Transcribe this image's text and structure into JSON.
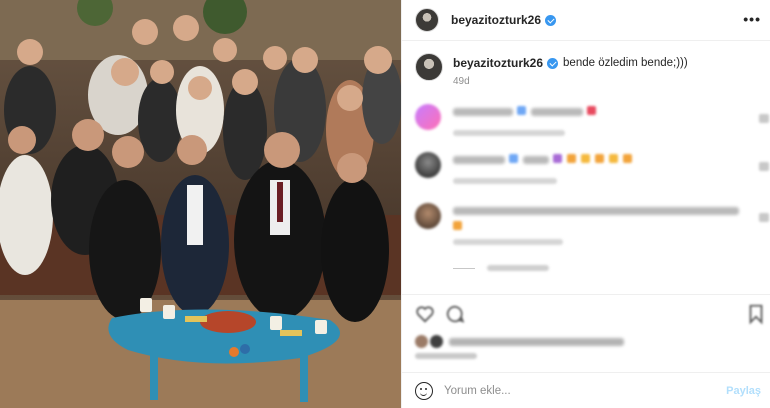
{
  "post": {
    "username": "beyazitozturk26",
    "verified": true,
    "more_icon": "more-horizontal-icon"
  },
  "caption": {
    "username": "beyazitozturk26",
    "text": "bende özledim bende;)))",
    "time": "49d"
  },
  "comments": [
    {
      "blurred": true,
      "accent_colors": [
        "#6fa7f5",
        "#e84a5f"
      ]
    },
    {
      "blurred": true,
      "accent_colors": [
        "#6fa7f5",
        "#a86bd6",
        "#f2a33a",
        "#f5b93d"
      ]
    },
    {
      "blurred": true,
      "accent_colors": [
        "#f2a33a"
      ]
    }
  ],
  "actions": {
    "icons": [
      "heart-icon",
      "comment-icon",
      "bookmark-icon"
    ]
  },
  "add_comment": {
    "placeholder": "Yorum ekle...",
    "post_label": "Paylaş"
  },
  "colors": {
    "verified_blue": "#3897f0",
    "post_button_disabled": "#b2dffc",
    "muted_text": "#8e8e8e",
    "border": "#efefef"
  }
}
